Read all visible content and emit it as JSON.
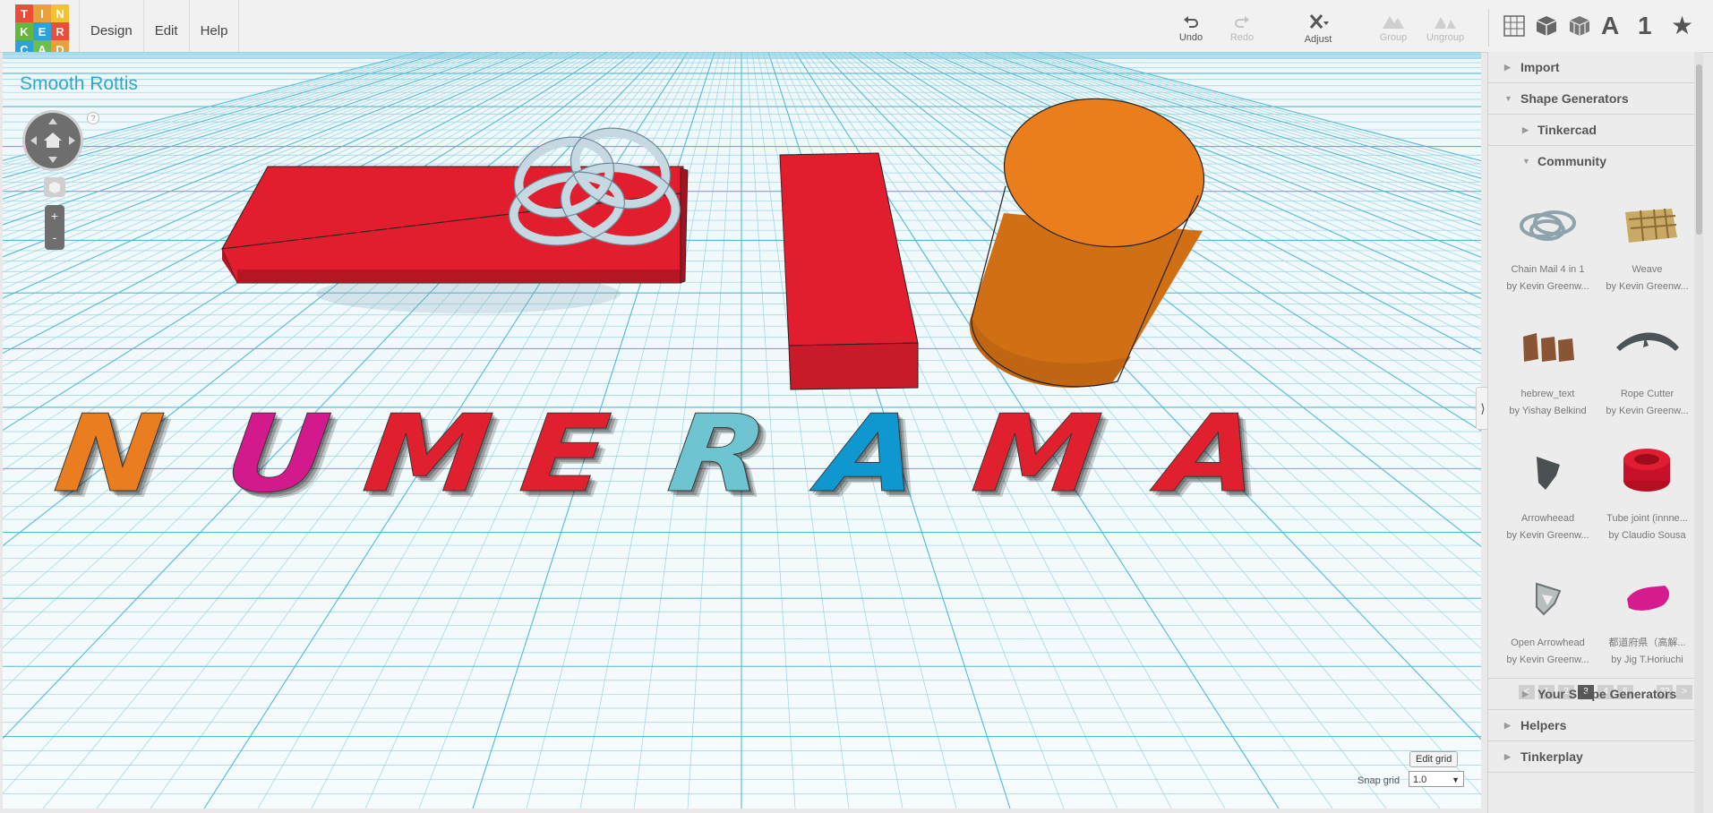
{
  "logo": {
    "letters": [
      "T",
      "I",
      "N",
      "K",
      "E",
      "R",
      "C",
      "A",
      "D"
    ],
    "colors": [
      "#e84e3a",
      "#e8a13a",
      "#f2c32e",
      "#67b43f",
      "#2ea1d8",
      "#e84e3a",
      "#2ea1d8",
      "#6bbf4a",
      "#e8a13a"
    ]
  },
  "menu": {
    "design": "Design",
    "edit": "Edit",
    "help": "Help"
  },
  "toolbar": {
    "undo": "Undo",
    "redo": "Redo",
    "adjust": "Adjust",
    "group": "Group",
    "ungroup": "Ungroup"
  },
  "view_tools": {
    "text_tool": "A",
    "number_tool": "1",
    "star_tool": "★"
  },
  "project_title": "Smooth Rottis",
  "nav": {
    "help": "?",
    "zoom_in": "+",
    "zoom_out": "-"
  },
  "canvas_text": [
    "N",
    "U",
    "M",
    "E",
    "R",
    "A",
    "M",
    "A"
  ],
  "canvas_colors": [
    "#e97d1f",
    "#d31a8c",
    "#e0202f",
    "#e0202f",
    "#6fc4d1",
    "#0e98cf",
    "#e0202f",
    "#e0202f",
    "#e0202f"
  ],
  "sidebar": {
    "import": "Import",
    "shape_generators": "Shape Generators",
    "tinkercad": "Tinkercad",
    "community": "Community",
    "your_shape_generators": "Your Shape Generators",
    "helpers": "Helpers",
    "tinkerplay": "Tinkerplay",
    "cards": [
      {
        "name": "Chain Mail 4 in 1",
        "author": "by Kevin Greenw..."
      },
      {
        "name": "Weave",
        "author": "by Kevin Greenw..."
      },
      {
        "name": "hebrew_text",
        "author": "by Yishay Belkind"
      },
      {
        "name": "Rope Cutter",
        "author": "by Kevin Greenw..."
      },
      {
        "name": "Arrowheead",
        "author": "by Kevin Greenw..."
      },
      {
        "name": "Tube joint (innne...",
        "author": "by Claudio Sousa"
      },
      {
        "name": "Open Arrowhead",
        "author": "by Kevin Greenw..."
      },
      {
        "name": "都道府県（高解...",
        "author": "by Jig T.Horiuchi"
      }
    ],
    "pager": [
      "<",
      "1",
      "2",
      "3",
      "4",
      "5",
      "...",
      "23",
      ">"
    ]
  },
  "grid_controls": {
    "edit_grid": "Edit grid",
    "snap_grid": "Snap grid",
    "snap_value": "1.0"
  }
}
